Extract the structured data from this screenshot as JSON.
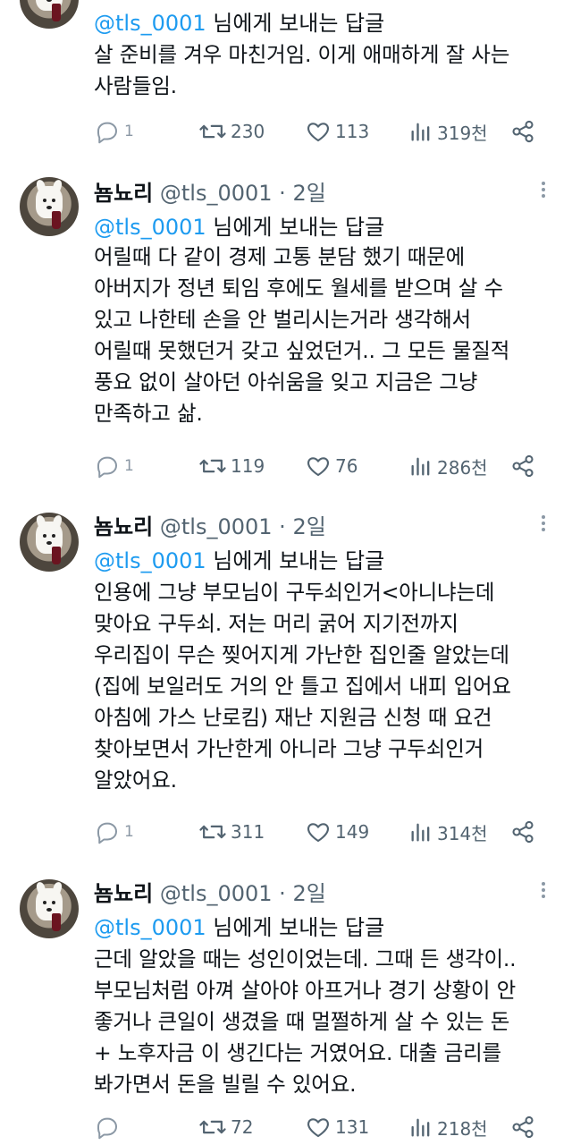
{
  "tweets": [
    {
      "name": "",
      "handle": "",
      "replying_mention": "@tls_0001",
      "replying_suffix": " 님에게 보내는 답글",
      "text": "살 준비를 겨우 마친거임. 이게 애매하게 잘 사는\n사람들임.",
      "replies": "1",
      "retweets": "230",
      "likes": "113",
      "views": "319천"
    },
    {
      "name": "뇸뇨리",
      "handle": "@tls_0001 · 2일",
      "replying_mention": "@tls_0001",
      "replying_suffix": " 님에게 보내는 답글",
      "text": "어릴때 다 같이 경제 고통 분담 했기 때문에\n아버지가 정년 퇴임 후에도 월세를 받으며 살 수\n있고 나한테 손을 안 벌리시는거라 생각해서\n어릴때 못했던거 갖고 싶었던거.. 그 모든 물질적\n풍요 없이 살아던 아쉬움을 잊고 지금은 그냥\n만족하고 삶.",
      "replies": "1",
      "retweets": "119",
      "likes": "76",
      "views": "286천"
    },
    {
      "name": "뇸뇨리",
      "handle": "@tls_0001 · 2일",
      "replying_mention": "@tls_0001",
      "replying_suffix": " 님에게 보내는 답글",
      "text": "인용에 그냥 부모님이 구두쇠인거<아니냐는데\n맞아요 구두쇠. 저는 머리 굵어 지기전까지\n우리집이 무슨 찢어지게 가난한 집인줄 알았는데\n(집에 보일러도 거의 안 틀고 집에서 내피 입어요\n아침에 가스 난로킴) 재난 지원금 신청 때 요건\n찾아보면서 가난한게 아니라 그냥 구두쇠인거\n알았어요.",
      "replies": "1",
      "retweets": "311",
      "likes": "149",
      "views": "314천"
    },
    {
      "name": "뇸뇨리",
      "handle": "@tls_0001 · 2일",
      "replying_mention": "@tls_0001",
      "replying_suffix": " 님에게 보내는 답글",
      "text": "근데 알았을 때는 성인이었는데. 그때 든 생각이..\n부모님처럼 아껴 살아야 아프거나 경기 상황이 안\n좋거나 큰일이 생겼을 때 멀쩔하게 살 수 있는 돈\n+ 노후자금 이 생긴다는 거였어요. 대출 금리를\n봐가면서 돈을 빌릴 수 있어요.",
      "replies": "",
      "retweets": "72",
      "likes": "131",
      "views": "218천"
    }
  ],
  "icons": {
    "reply": "speech-bubble",
    "retweet": "repost-arrows",
    "like": "heart",
    "views": "bar-chart",
    "share": "share-nodes",
    "more": "vertical-dots"
  },
  "colors": {
    "text": "#0f1419",
    "secondary": "#536471",
    "mention": "#1d9bf0",
    "background": "#ffffff"
  }
}
